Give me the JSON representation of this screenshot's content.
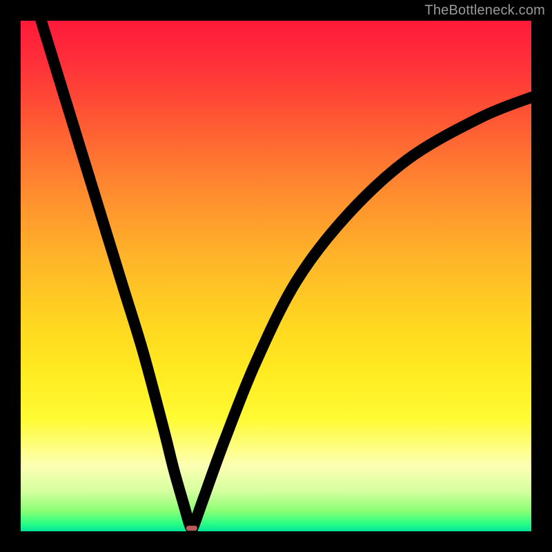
{
  "watermark": "TheBottleneck.com",
  "colors": {
    "frame": "#000000",
    "gradient_top": "#ff1a3a",
    "gradient_bottom": "#00e49a",
    "curve": "#000000",
    "marker": "#d86a6a",
    "watermark_text": "#9a9a9a"
  },
  "chart_data": {
    "type": "line",
    "title": "",
    "xlabel": "",
    "ylabel": "",
    "xlim": [
      0,
      100
    ],
    "ylim": [
      0,
      100
    ],
    "grid": false,
    "legend": false,
    "series": [
      {
        "name": "bottleneck-curve",
        "x": [
          4,
          8,
          12,
          16,
          20,
          24,
          28,
          30,
          32,
          33,
          33.5,
          34,
          36,
          40,
          46,
          54,
          64,
          76,
          90,
          100
        ],
        "y": [
          100,
          87,
          74,
          61,
          48,
          35,
          20,
          12,
          5,
          1.5,
          0.6,
          1.4,
          7,
          18,
          33,
          49,
          62,
          73,
          81,
          85
        ]
      }
    ],
    "annotations": [
      {
        "name": "minimum-marker",
        "type": "marker",
        "shape": "rounded-rect",
        "x": 33.5,
        "y": 0.6,
        "width_pct": 2.2,
        "height_pct": 1.0
      }
    ],
    "background": {
      "type": "vertical-gradient",
      "stops": [
        {
          "pos": 0.0,
          "color": "#ff1a3a"
        },
        {
          "pos": 0.2,
          "color": "#ff5a33"
        },
        {
          "pos": 0.46,
          "color": "#ffb329"
        },
        {
          "pos": 0.68,
          "color": "#ffe91f"
        },
        {
          "pos": 0.87,
          "color": "#fdffb2"
        },
        {
          "pos": 0.96,
          "color": "#8bff75"
        },
        {
          "pos": 1.0,
          "color": "#00e49a"
        }
      ]
    }
  }
}
